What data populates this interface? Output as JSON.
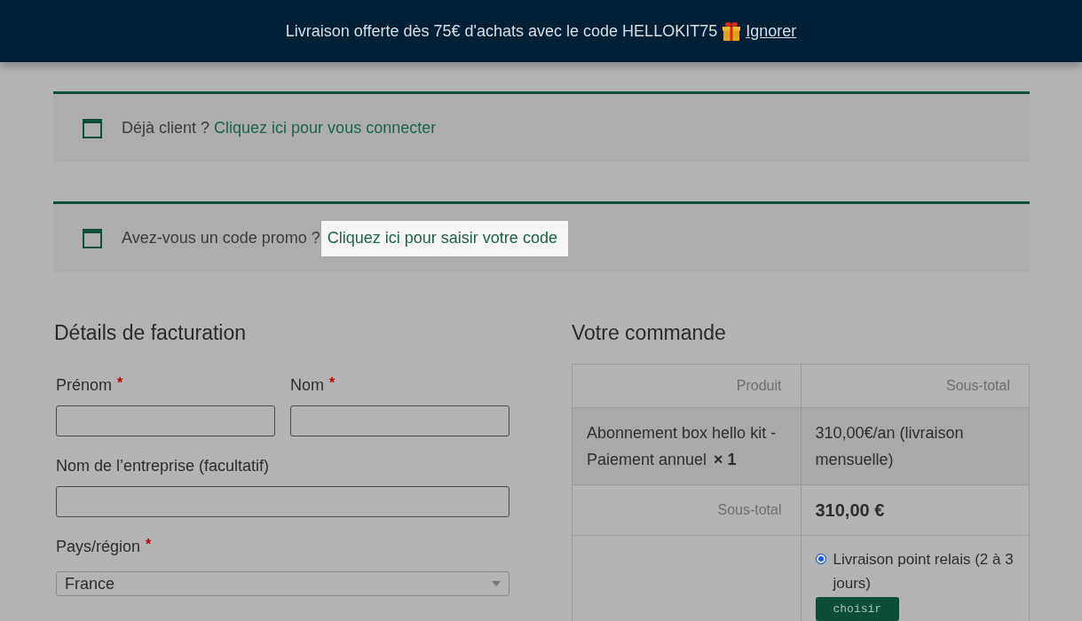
{
  "banner": {
    "text": "Livraison offerte dès 75€ d'achats avec le code HELLOKIT75",
    "dismiss": "Ignorer"
  },
  "notices": [
    {
      "text": "Déjà client ?",
      "link": "Cliquez ici pour vous connecter",
      "highlighted": false
    },
    {
      "text": "Avez-vous un code promo ?",
      "link": "Cliquez ici pour saisir votre code",
      "highlighted": true
    }
  ],
  "billing": {
    "title": "Détails de facturation",
    "rows": [
      {
        "fields": [
          {
            "kind": "text",
            "label": "Prénom",
            "required_mark": "*"
          },
          {
            "kind": "text",
            "label": "Nom",
            "required_mark": "*"
          }
        ]
      },
      {
        "fields": [
          {
            "kind": "text",
            "label": "Nom de l’entreprise (facultatif)"
          }
        ]
      },
      {
        "fields": [
          {
            "kind": "select",
            "label": "Pays/région",
            "required_mark": "*",
            "value": "France"
          }
        ]
      }
    ]
  },
  "order": {
    "title": "Votre commande",
    "columns": [
      "Produit",
      "Sous-total"
    ],
    "items": [
      {
        "name": "Abonnement box hello kit - Paiement annuel",
        "quantity": "× 1",
        "total": "310,00€/an (livraison mensuelle)"
      }
    ],
    "subtotal": {
      "label": "Sous-total",
      "value": "310,00 €"
    },
    "shipping_options": [
      {
        "label": "Livraison point relais (2 à 3 jours)",
        "selected": true,
        "action": "choisir"
      }
    ]
  }
}
